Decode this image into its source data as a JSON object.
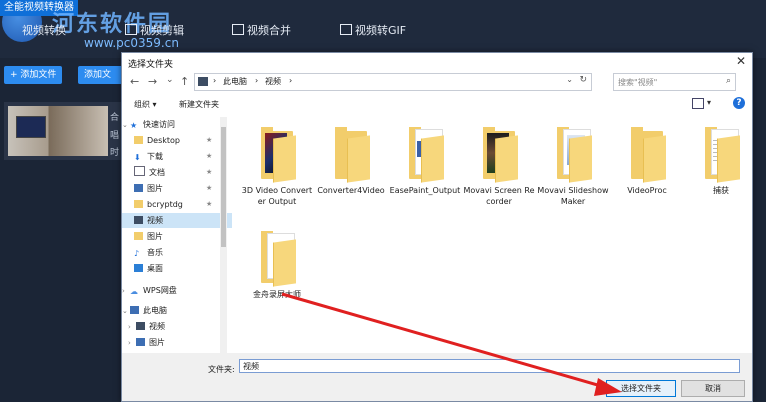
{
  "app": {
    "title": "全能视频转换器",
    "watermark": "河东软件园",
    "watermark_url": "www.pc0359.cn",
    "tabs": [
      {
        "label": "视频转换"
      },
      {
        "label": "视频剪辑"
      },
      {
        "label": "视频合并"
      },
      {
        "label": "视频转GIF"
      }
    ],
    "toolbar": {
      "add_file": "+ 添加文件",
      "add_folder": "添加文"
    },
    "side_text": [
      "合",
      "唱",
      "时"
    ]
  },
  "dialog": {
    "title": "选择文件夹",
    "close": "✕",
    "nav": {
      "back": "←",
      "forward": "→",
      "dropdown": "⌄",
      "up": "↑"
    },
    "address": [
      "此电脑",
      "视频"
    ],
    "address_seps": [
      "›",
      "›",
      "›"
    ],
    "search_placeholder": "搜索\"视频\"",
    "commands": {
      "organize": "组织 ▾",
      "new_folder": "新建文件夹"
    },
    "sidebar": [
      {
        "label": "快速访问",
        "tri": "⌄",
        "pin": ""
      },
      {
        "label": "Desktop",
        "tri": "",
        "pin": "★"
      },
      {
        "label": "下载",
        "tri": "",
        "pin": "★"
      },
      {
        "label": "文档",
        "tri": "",
        "pin": "★"
      },
      {
        "label": "图片",
        "tri": "",
        "pin": "★"
      },
      {
        "label": "bcryptdg",
        "tri": "",
        "pin": "★"
      },
      {
        "label": "视频",
        "tri": "",
        "pin": ""
      },
      {
        "label": "图片",
        "tri": "",
        "pin": ""
      },
      {
        "label": "音乐",
        "tri": "",
        "pin": ""
      },
      {
        "label": "桌面",
        "tri": "",
        "pin": ""
      },
      {
        "label": "WPS网盘",
        "tri": "›",
        "pin": ""
      },
      {
        "label": "此电脑",
        "tri": "⌄",
        "pin": ""
      },
      {
        "label": "视频",
        "tri": "›",
        "pin": ""
      },
      {
        "label": "图片",
        "tri": "›",
        "pin": ""
      }
    ],
    "files": [
      {
        "name": "3D Video Converter Output"
      },
      {
        "name": "Converter4Video"
      },
      {
        "name": "EasePaint_Output"
      },
      {
        "name": "Movavi Screen Recorder"
      },
      {
        "name": "Movavi Slideshow Maker"
      },
      {
        "name": "VideoProc"
      },
      {
        "name": "捕获"
      },
      {
        "name": "金舟录屏大师"
      }
    ],
    "footer": {
      "folder_label": "文件夹:",
      "folder_value": "视频",
      "select_button": "选择文件夹",
      "cancel_button": "取消"
    }
  },
  "colors": {
    "accent": "#0e6fd8",
    "folder": "#f2cd6b",
    "arrow": "#e02020",
    "dialog_bg": "#ffffff"
  }
}
